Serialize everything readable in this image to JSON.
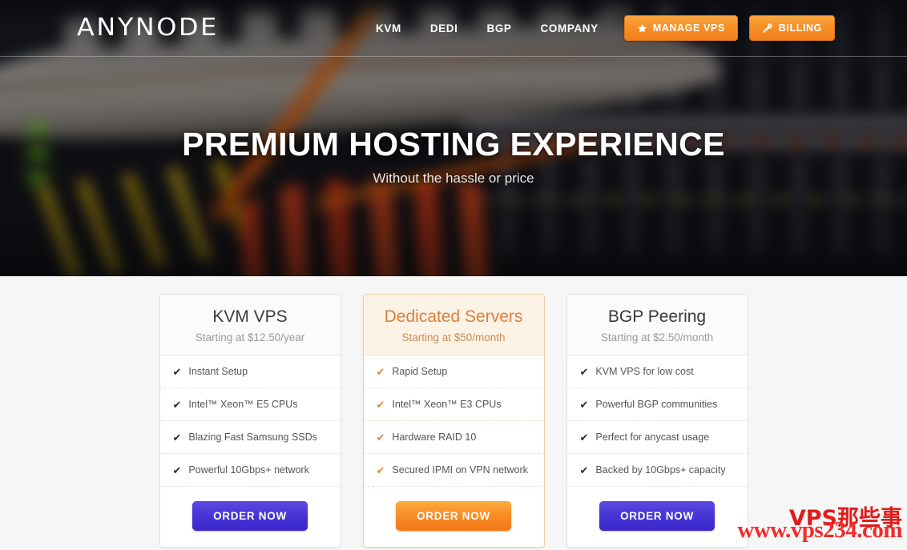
{
  "brand": {
    "logo_text": "ANYNODE"
  },
  "nav": {
    "links": [
      {
        "label": "KVM",
        "name": "nav-link-kvm"
      },
      {
        "label": "DEDI",
        "name": "nav-link-dedi"
      },
      {
        "label": "BGP",
        "name": "nav-link-bgp"
      },
      {
        "label": "COMPANY",
        "name": "nav-link-company"
      }
    ],
    "buttons": [
      {
        "label": "MANAGE VPS",
        "icon": "star-icon"
      },
      {
        "label": "BILLING",
        "icon": "key-icon"
      }
    ]
  },
  "hero": {
    "title": "PREMIUM HOSTING EXPERIENCE",
    "subtitle": "Without the hassle or price"
  },
  "pricing": {
    "check_glyph": "✔",
    "cards": [
      {
        "title": "KVM VPS",
        "price": "Starting at $12.50/year",
        "featured": false,
        "features": [
          "Instant Setup",
          "Intel™ Xeon™ E5 CPUs",
          "Blazing Fast Samsung SSDs",
          "Powerful 10Gbps+ network"
        ],
        "cta": "ORDER NOW",
        "cta_color": "#4634d4"
      },
      {
        "title": "Dedicated Servers",
        "price": "Starting at $50/month",
        "featured": true,
        "features": [
          "Rapid Setup",
          "Intel™ Xeon™ E3 CPUs",
          "Hardware RAID 10",
          "Secured IPMI on VPN network"
        ],
        "cta": "ORDER NOW",
        "cta_color": "#f78c25"
      },
      {
        "title": "BGP Peering",
        "price": "Starting at $2.50/month",
        "featured": false,
        "features": [
          "KVM VPS for low cost",
          "Powerful BGP communities",
          "Perfect for anycast usage",
          "Backed by 10Gbps+ capacity"
        ],
        "cta": "ORDER NOW",
        "cta_color": "#4634d4"
      }
    ]
  },
  "watermark": {
    "line1": "VPS那些事",
    "line2": "www.vps234.com",
    "color": "#e81c1c"
  },
  "colors": {
    "accent_orange": "#f78c25",
    "accent_purple": "#4634d4",
    "page_bg": "#f6f6f6"
  }
}
